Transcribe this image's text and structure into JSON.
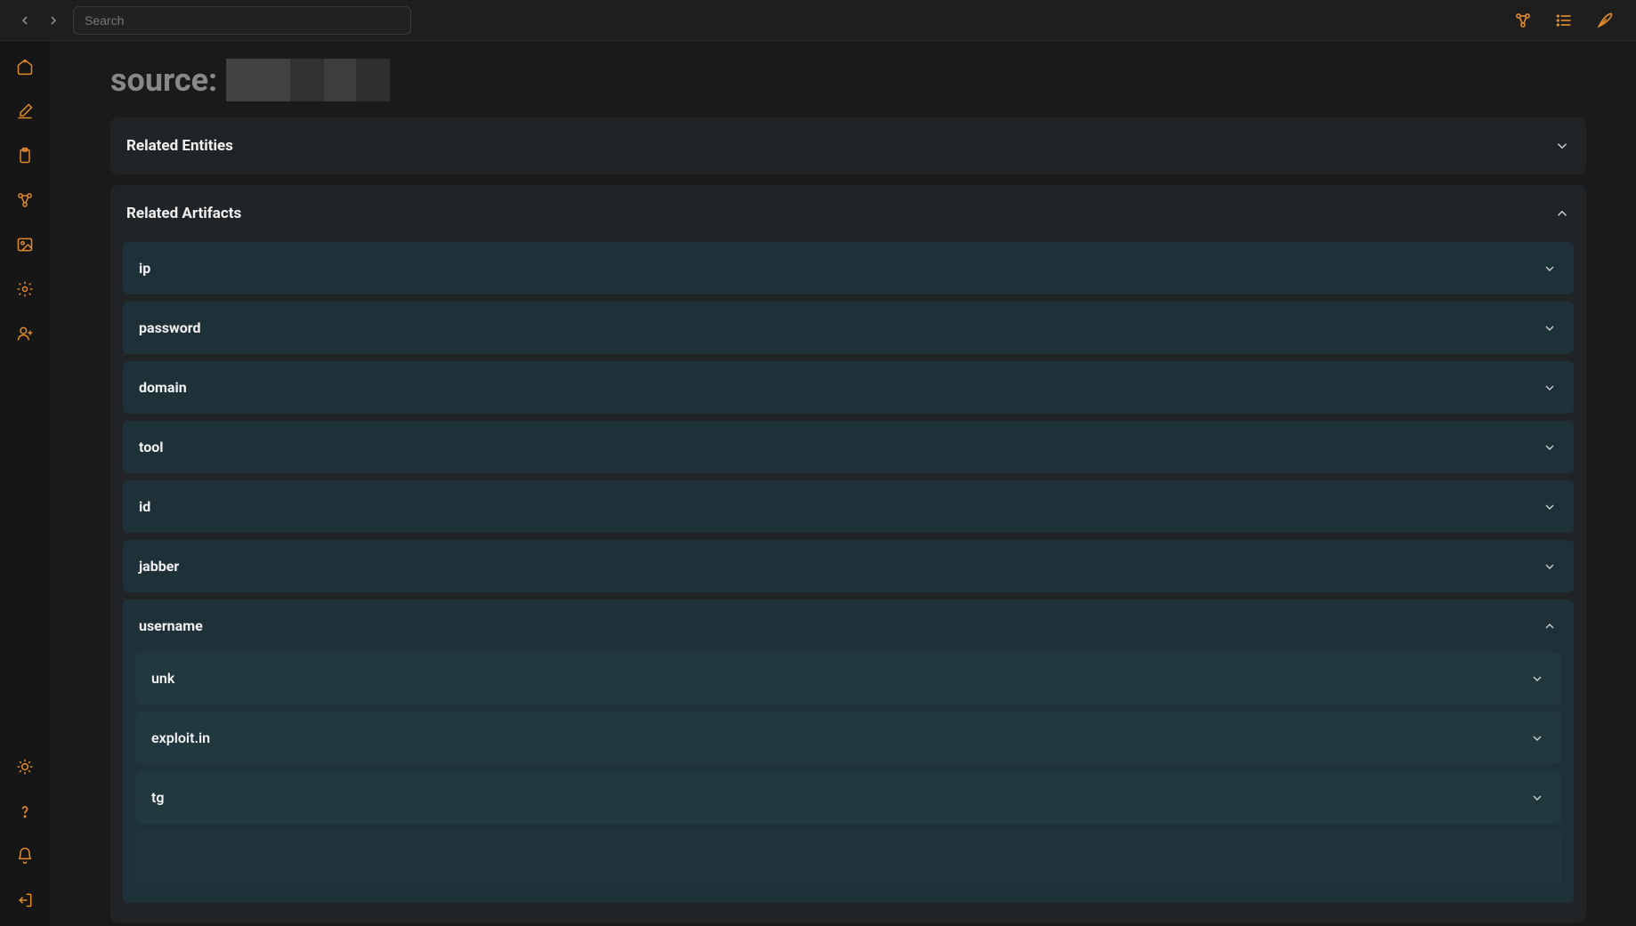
{
  "search": {
    "placeholder": "Search"
  },
  "page": {
    "title_prefix": "source:"
  },
  "sections": {
    "related_entities": {
      "title": "Related Entities",
      "expanded": false
    },
    "related_artifacts": {
      "title": "Related Artifacts",
      "expanded": true,
      "items": [
        {
          "label": "ip",
          "expanded": false
        },
        {
          "label": "password",
          "expanded": false
        },
        {
          "label": "domain",
          "expanded": false
        },
        {
          "label": "tool",
          "expanded": false
        },
        {
          "label": "id",
          "expanded": false
        },
        {
          "label": "jabber",
          "expanded": false
        },
        {
          "label": "username",
          "expanded": true,
          "children": [
            {
              "label": "unk"
            },
            {
              "label": "exploit.in"
            },
            {
              "label": "tg"
            }
          ]
        }
      ]
    }
  }
}
